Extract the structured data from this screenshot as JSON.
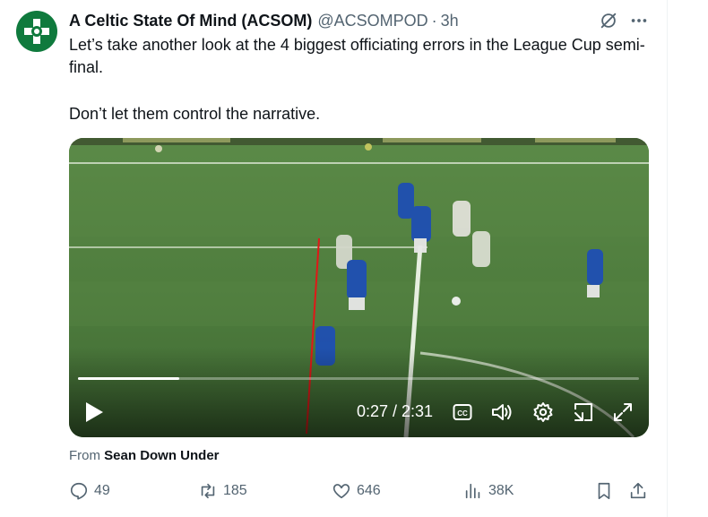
{
  "tweet": {
    "display_name": "A Celtic State Of Mind (ACSOM)",
    "handle": "@ACSOMPOD",
    "separator": "·",
    "time": "3h",
    "text_line1": "Let’s take another look at the 4 biggest officiating errors in the League Cup semi-final.",
    "text_line2": "Don’t let them control the narrative.",
    "from_prefix": "From",
    "from_source": "Sean Down Under"
  },
  "video": {
    "time_display": "0:27 / 2:31",
    "progress": 0.18,
    "cc_label": "CC"
  },
  "actions": {
    "replies": "49",
    "reposts": "185",
    "likes": "646",
    "views": "38K"
  },
  "colors": {
    "text": "#0f1419",
    "muted": "#536471",
    "avatar_green": "#0f7a3d",
    "pitch": "#4d7a3f",
    "rangers_blue": "#1f4fb3"
  },
  "icons": [
    "grok-icon",
    "more-icon",
    "play-icon",
    "cc-icon",
    "volume-icon",
    "settings-gear-icon",
    "pip-icon",
    "fullscreen-icon",
    "reply-icon",
    "repost-icon",
    "like-icon",
    "views-icon",
    "bookmark-icon",
    "share-icon"
  ]
}
